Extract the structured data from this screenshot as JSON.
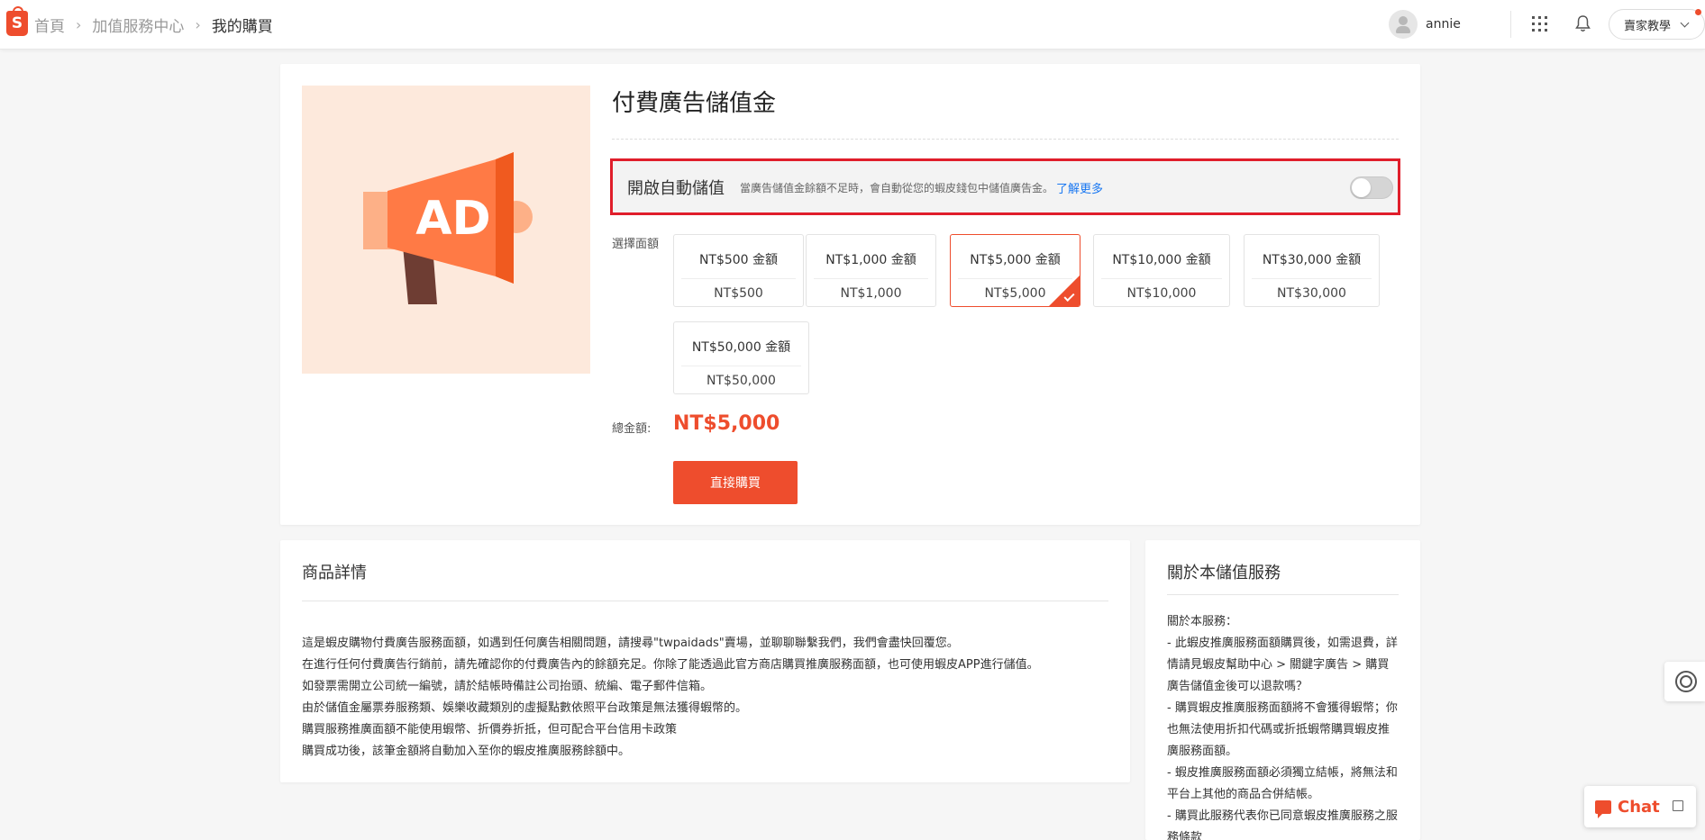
{
  "header": {
    "breadcrumbs": [
      "首頁",
      "加值服務中心",
      "我的購買"
    ],
    "user": "annie",
    "teach_label": "賣家教學"
  },
  "product": {
    "title": "付費廣告儲值金",
    "banner_text": "AD",
    "auto_topup": {
      "title": "開啟自動儲值",
      "desc": "當廣告儲值金餘額不足時，會自動從您的蝦皮錢包中儲值廣告金。",
      "link": "了解更多",
      "enabled": false
    },
    "amount_label": "選擇面額",
    "options": [
      {
        "title": "NT$500 金額",
        "price": "NT$500"
      },
      {
        "title": "NT$1,000 金額",
        "price": "NT$1,000"
      },
      {
        "title": "NT$5,000 金額",
        "price": "NT$5,000",
        "selected": true
      },
      {
        "title": "NT$10,000 金額",
        "price": "NT$10,000"
      },
      {
        "title": "NT$30,000 金額",
        "price": "NT$30,000"
      },
      {
        "title": "NT$50,000 金額",
        "price": "NT$50,000"
      }
    ],
    "total_label": "總金額:",
    "total": "NT$5,000",
    "buy_label": "直接購買"
  },
  "details": {
    "title": "商品詳情",
    "lines": [
      "這是蝦皮購物付費廣告服務面額，如遇到任何廣告相關問題，請搜尋\"twpaidads\"賣場，並聊聊聯繫我們，我們會盡快回覆您。",
      "在進行任何付費廣告行銷前，請先確認你的付費廣告內的餘額充足。你除了能透過此官方商店購買推廣服務面額，也可使用蝦皮APP進行儲值。",
      "如發票需開立公司統一編號，請於結帳時備註公司抬頭、統編、電子郵件信箱。",
      "由於儲值金屬票券服務類、娛樂收藏類別的虛擬點數依照平台政策是無法獲得蝦幣的。",
      "購買服務推廣面額不能使用蝦幣、折價券折抵，但可配合平台信用卡政策",
      "購買成功後，該筆金額將自動加入至你的蝦皮推廣服務餘額中。"
    ]
  },
  "about": {
    "title": "關於本儲值服務",
    "lines": [
      "關於本服務：",
      "- 此蝦皮推廣服務面額購買後，如需退費，詳情請見蝦皮幫助中心 > 關鍵字廣告 > 購買廣告儲值金後可以退款嗎？",
      "- 購買蝦皮推廣服務面額將不會獲得蝦幣；你也無法使用折扣代碼或折抵蝦幣購買蝦皮推廣服務面額。",
      "- 蝦皮推廣服務面額必須獨立結帳，將無法和平台上其他的商品合併結帳。",
      "- 購買此服務代表你已同意蝦皮推廣服務之服務條款"
    ]
  },
  "chat": {
    "label": "Chat"
  },
  "colors": {
    "accent": "#ee4d2d",
    "highlight_border": "#e01e2b",
    "link": "#1877f2"
  },
  "icons": [
    "shopee-logo-icon",
    "chevron-right-icon",
    "avatar-icon",
    "apps-grid-icon",
    "bell-icon",
    "chevron-down-icon",
    "megaphone-icon",
    "check-icon",
    "headset-icon",
    "chat-icon",
    "expand-icon"
  ]
}
